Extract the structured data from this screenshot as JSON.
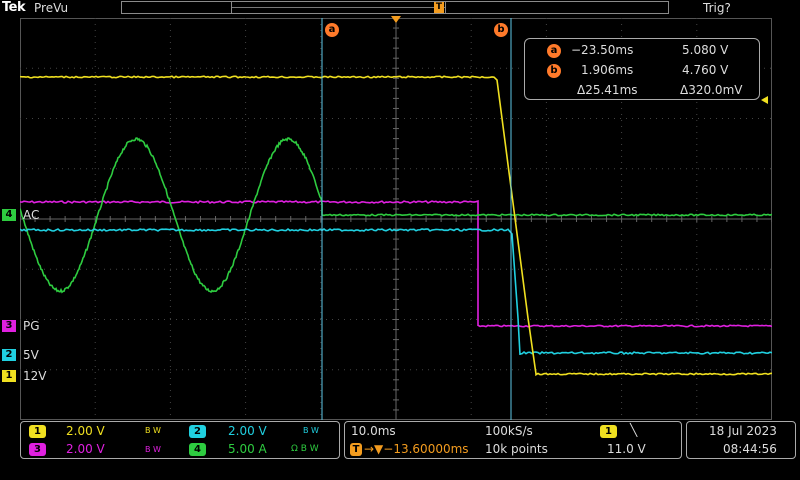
{
  "header": {
    "brand": "Tek",
    "mode": "PreVu",
    "trigger_status": "Trig?",
    "trigger_marker": "T"
  },
  "channels": [
    {
      "number": "4",
      "label": "AC",
      "color": "#2ecc40"
    },
    {
      "number": "3",
      "label": "PG",
      "color": "#e020e0"
    },
    {
      "number": "2",
      "label": "5V",
      "color": "#20d0e0"
    },
    {
      "number": "1",
      "label": "12V",
      "color": "#f0e020"
    }
  ],
  "cursors": {
    "a_label": "a",
    "b_label": "b",
    "a_time": "−23.50ms",
    "a_value": "5.080 V",
    "b_time": "1.906ms",
    "b_value": "4.760 V",
    "delta_time": "Δ25.41ms",
    "delta_value": "Δ320.0mV"
  },
  "bottom": {
    "ch1": {
      "num": "1",
      "scale": "2.00 V",
      "bw": "B W"
    },
    "ch2": {
      "num": "2",
      "scale": "2.00 V",
      "bw": "B W"
    },
    "ch3": {
      "num": "3",
      "scale": "2.00 V",
      "bw": "B W"
    },
    "ch4": {
      "num": "4",
      "scale": "5.00 A",
      "bw": "Ω B W"
    },
    "timebase": "10.0ms",
    "sample_rate": "100kS/s",
    "delay": "→▼−13.60000ms",
    "record_length": "10k points",
    "trigger_source": "1",
    "trigger_slope": "╲",
    "trigger_level": "11.0 V",
    "date": "18 Jul  2023",
    "time": "08:44:56"
  },
  "colors": {
    "ch1": "#f0e020",
    "ch2": "#20d0e0",
    "ch3": "#e020e0",
    "ch4": "#2ecc40",
    "cursor": "#ff7a2a",
    "trigger": "#f39c1f"
  }
}
